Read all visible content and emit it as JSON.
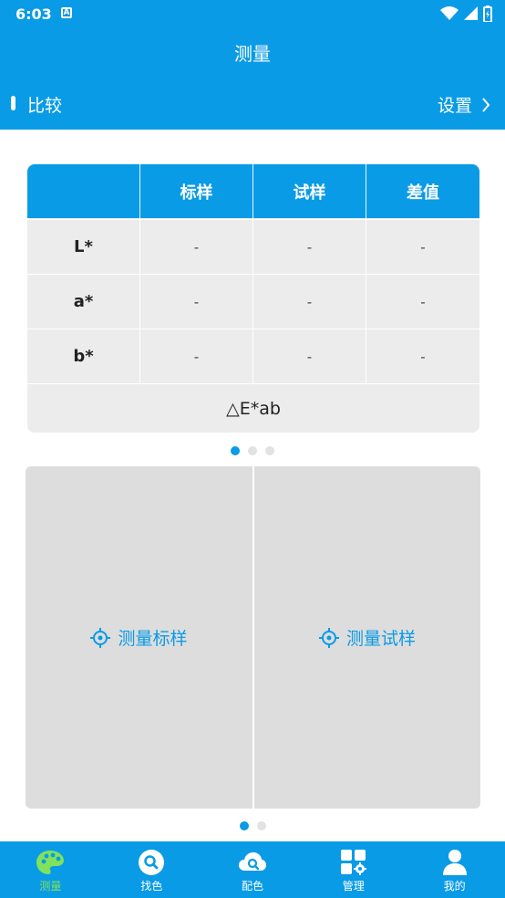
{
  "status": {
    "time": "6:03",
    "notif_letter": "A"
  },
  "header": {
    "title": "测量",
    "compare_label": "比较",
    "settings_label": "设置"
  },
  "table": {
    "headers": [
      "",
      "标样",
      "试样",
      "差值"
    ],
    "rows": [
      {
        "label": "L*",
        "standard": "-",
        "sample": "-",
        "diff": "-"
      },
      {
        "label": "a*",
        "standard": "-",
        "sample": "-",
        "diff": "-"
      },
      {
        "label": "b*",
        "standard": "-",
        "sample": "-",
        "diff": "-"
      }
    ],
    "delta_label": "△E*ab"
  },
  "pager_top": {
    "count": 3,
    "active": 0
  },
  "measure": {
    "standard_label": "测量标样",
    "sample_label": "测量试样"
  },
  "pager_bottom": {
    "count": 2,
    "active": 0
  },
  "nav": [
    {
      "label": "测量",
      "icon": "palette-icon",
      "active": true
    },
    {
      "label": "找色",
      "icon": "search-icon",
      "active": false
    },
    {
      "label": "配色",
      "icon": "cloud-search-icon",
      "active": false
    },
    {
      "label": "管理",
      "icon": "grid-gear-icon",
      "active": false
    },
    {
      "label": "我的",
      "icon": "user-icon",
      "active": false
    }
  ],
  "colors": {
    "primary": "#0a9be6",
    "active_nav": "#7fe25a",
    "panel": "#dddddd"
  }
}
